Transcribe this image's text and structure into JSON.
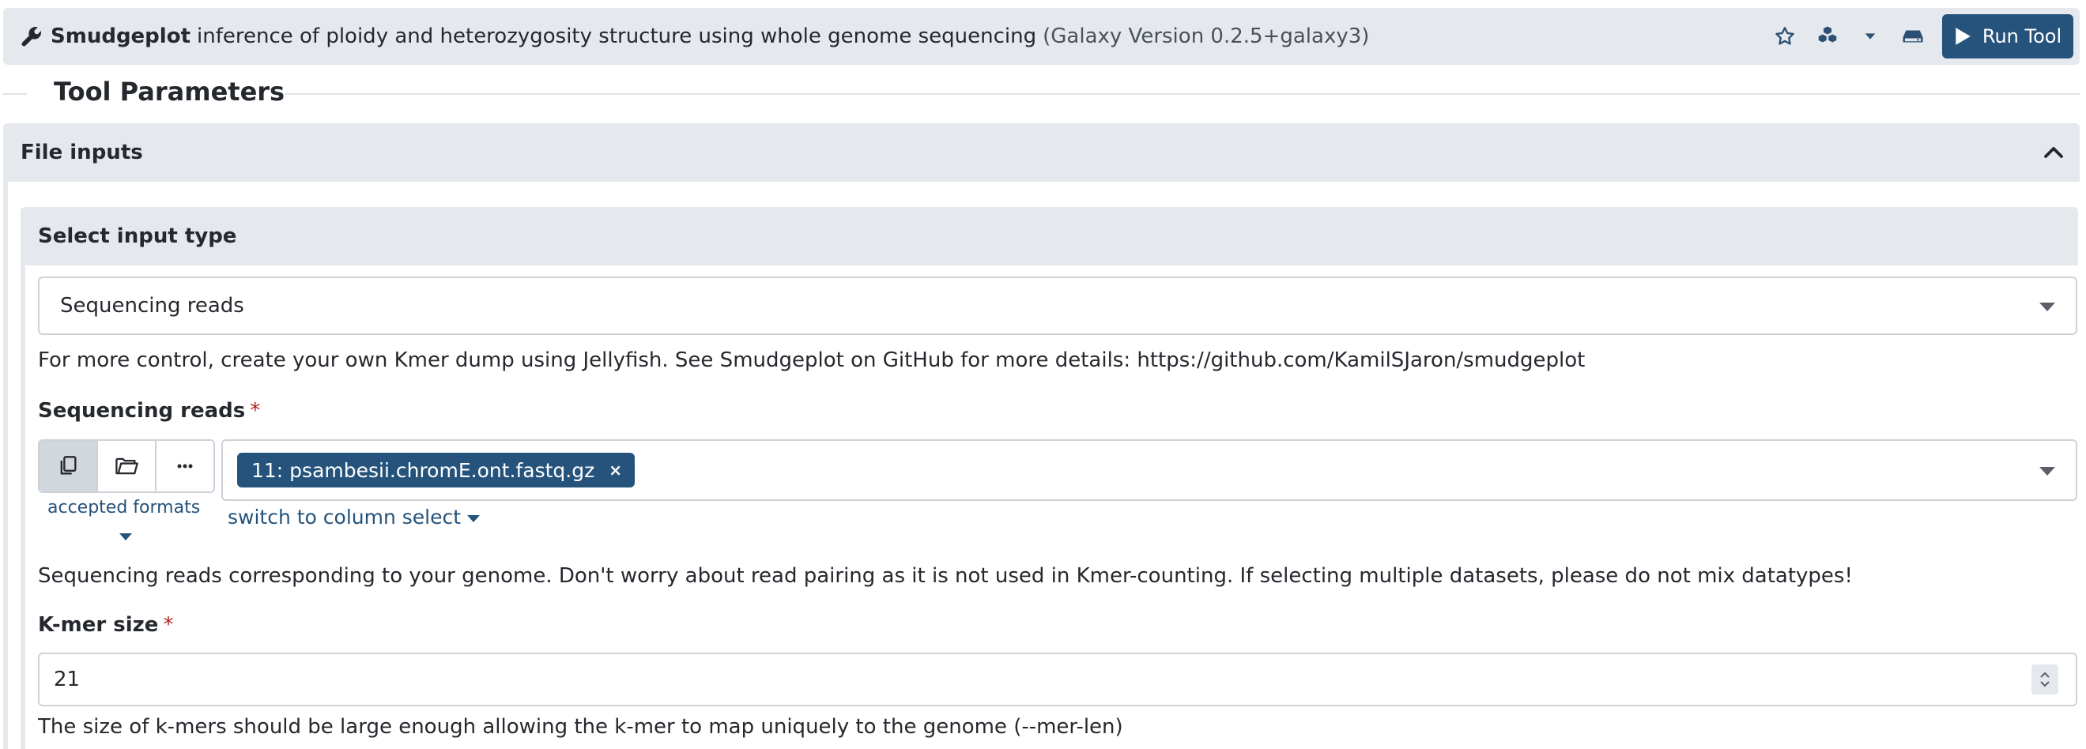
{
  "header": {
    "tool_name": "Smudgeplot",
    "tool_description": "inference of ploidy and heterozygosity structure using whole genome sequencing",
    "tool_version": "(Galaxy Version 0.2.5+galaxy3)",
    "icons": [
      "wrench-icon",
      "star-icon",
      "cubes-icon",
      "caret-down-icon",
      "hdd-icon"
    ],
    "run_label": "Run Tool",
    "accent_color": "#25537b"
  },
  "tool_parameters": {
    "title": "Tool Parameters"
  },
  "file_inputs": {
    "title": "File inputs",
    "expanded": true,
    "input_type": {
      "title": "Select input type",
      "selected": "Sequencing reads",
      "help": "For more control, create your own Kmer dump using Jellyfish. See Smudgeplot on GitHub for more details: https://github.com/KamilSJaron/smudgeplot"
    },
    "sequencing_reads": {
      "label": "Sequencing reads",
      "required_mark": "*",
      "accepted_formats": "accepted formats",
      "selected_dataset": "11: psambesii.chromE.ont.fastq.gz",
      "remove_symbol": "×",
      "switch_label": "switch to column select",
      "help": "Sequencing reads corresponding to your genome. Don't worry about read pairing as it is not used in Kmer-counting. If selecting multiple datasets, please do not mix datatypes!"
    },
    "kmer_size": {
      "label": "K-mer size",
      "required_mark": "*",
      "value": "21",
      "help": "The size of k-mers should be large enough allowing the k-mer to map uniquely to the genome (--mer-len)"
    }
  }
}
